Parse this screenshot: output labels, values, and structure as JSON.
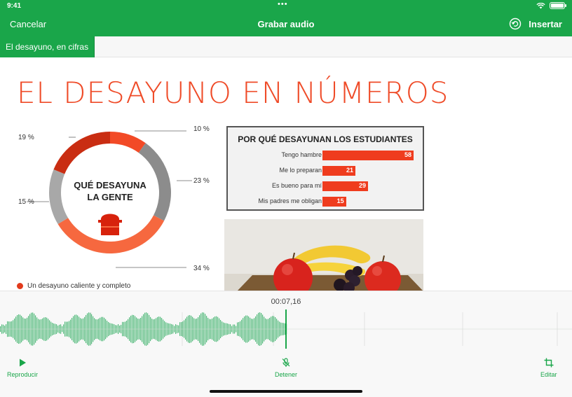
{
  "status_bar": {
    "time": "9:41",
    "dots": "•••"
  },
  "nav": {
    "cancel_label": "Cancelar",
    "title": "Grabar audio",
    "insert_label": "Insertar",
    "undo_icon": "undo-circle-icon"
  },
  "tabs": [
    {
      "label": "El desayuno, en cifras",
      "active": true
    }
  ],
  "slide": {
    "title": "EL DESAYUNO EN NÚMEROS",
    "donut": {
      "center_line1": "QUÉ DESAYUNA",
      "center_line2": "LA GENTE",
      "icon": "bread-toast-icon",
      "segments": [
        {
          "label": "10 %",
          "value": 10,
          "color": "#f24a26"
        },
        {
          "label": "23 %",
          "value": 23,
          "color": "#8c8c8c"
        },
        {
          "label": "34 %",
          "value": 34,
          "color": "#f6683f"
        },
        {
          "label": "15 %",
          "value": 15,
          "color": "#a8a8a8"
        },
        {
          "label": "19 %",
          "value": 19,
          "color": "#c92d12"
        }
      ]
    },
    "legend": [
      {
        "label": "Un desayuno caliente y completo",
        "color": "#e23a1c"
      }
    ],
    "photo_icon": "fruit-photo"
  },
  "chart_data": {
    "type": "bar",
    "title": "POR QUÉ DESAYUNAN LOS ESTUDIANTES",
    "categories": [
      "Tengo hambre",
      "Me lo preparan",
      "Es bueno para mí",
      "Mis padres me obligan"
    ],
    "values": [
      58,
      21,
      29,
      15
    ],
    "xlim": [
      0,
      58
    ],
    "color": "#ef3c1e"
  },
  "recorder": {
    "timecode": "00:07,16",
    "controls": {
      "play_label": "Reproducir",
      "stop_label": "Detener",
      "edit_label": "Editar"
    },
    "accent": "#1aa64a"
  }
}
